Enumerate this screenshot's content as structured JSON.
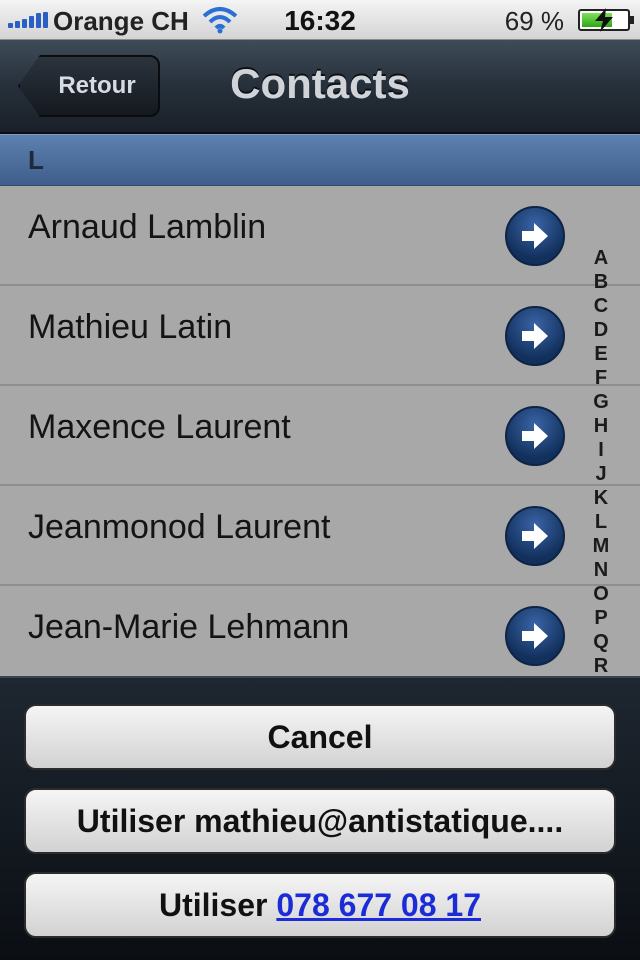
{
  "status_bar": {
    "carrier": "Orange CH",
    "time": "16:32",
    "battery": "69 %",
    "battery_level": 0.69
  },
  "nav": {
    "back_label": "Retour",
    "title": "Contacts"
  },
  "section": {
    "letter": "L"
  },
  "contacts": [
    {
      "name": "Arnaud Lamblin"
    },
    {
      "name": "Mathieu Latin"
    },
    {
      "name": "Maxence Laurent"
    },
    {
      "name": "Jeanmonod Laurent"
    },
    {
      "name": "Jean-Marie Lehmann"
    }
  ],
  "index_letters": [
    "A",
    "B",
    "C",
    "D",
    "E",
    "F",
    "G",
    "H",
    "I",
    "J",
    "K",
    "L",
    "M",
    "N",
    "O",
    "P",
    "Q",
    "R"
  ],
  "action_sheet": {
    "cancel_label": "Cancel",
    "email_label": "Utiliser mathieu@antistatique....",
    "phone_prefix": "Utiliser",
    "phone_number": "078 677 08 17"
  },
  "colors": {
    "section_header": "#4a6b98",
    "disclosure": "#1a3c70",
    "list_bg": "#a8a8a8"
  }
}
